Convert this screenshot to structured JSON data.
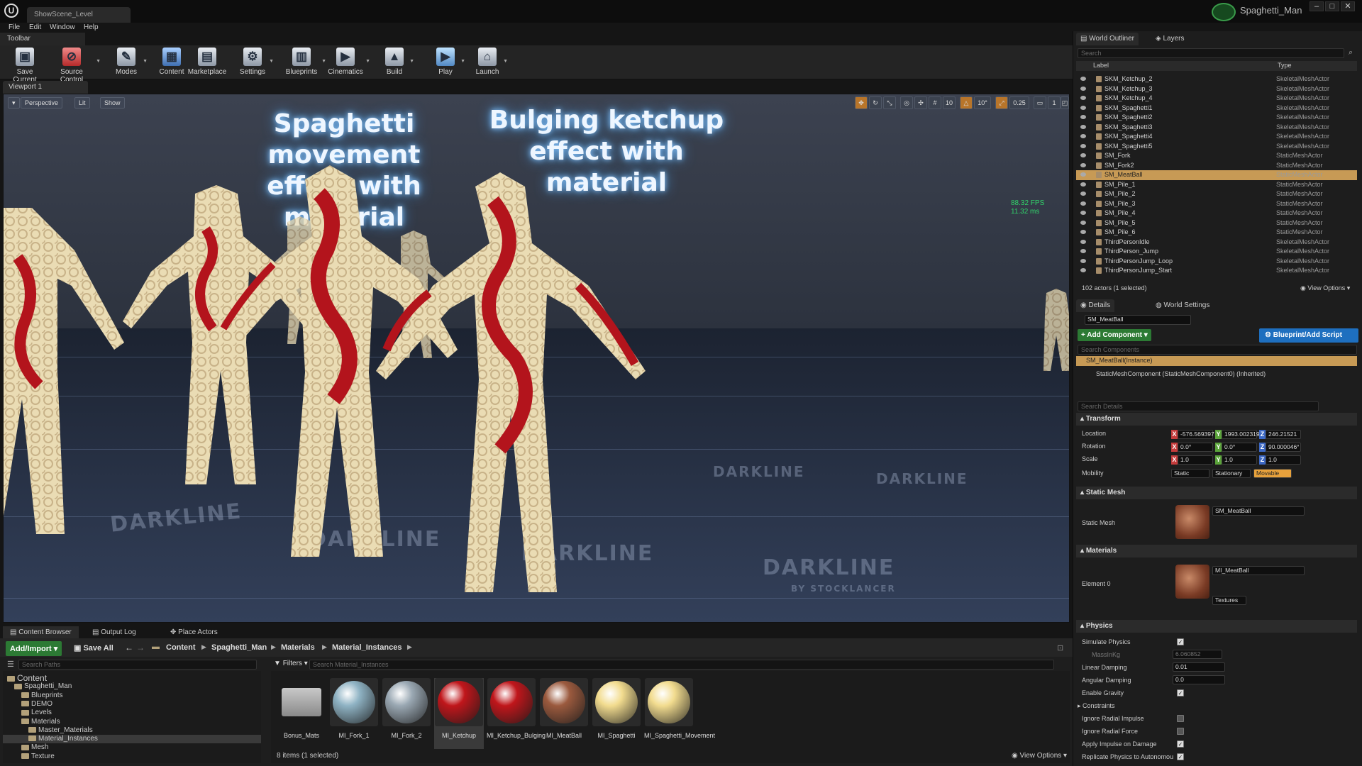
{
  "window": {
    "doc_tab": "ShowScene_Level",
    "user": "Spaghetti_Man",
    "controls": [
      "–",
      "□",
      "✕"
    ]
  },
  "menu": [
    "File",
    "Edit",
    "Window",
    "Help"
  ],
  "toolbar": {
    "tab": "Toolbar",
    "buttons": [
      "Save Current",
      "Source Control",
      "Modes",
      "Content",
      "Marketplace",
      "Settings",
      "Blueprints",
      "Cinematics",
      "Build",
      "Play",
      "Launch"
    ]
  },
  "viewport": {
    "tab": "Viewport 1",
    "perspective": "Perspective",
    "lit": "Lit",
    "show": "Show",
    "grid_snap": "10",
    "rot_snap": "10°",
    "scale_snap": "0.25",
    "cam_speed": "1",
    "fps": "88.32 FPS",
    "ms": "11.32 ms",
    "headline_left_1": "Spaghetti movement",
    "headline_left_2": "effect with material",
    "headline_right_1": "Bulging ketchup",
    "headline_right_2": "effect with material",
    "watermark": "DARKLINE",
    "watermark_sub": "BY STOCKLANCER"
  },
  "content_browser": {
    "tabs": [
      "Content Browser",
      "Output Log",
      "Place Actors"
    ],
    "add_import": "Add/Import",
    "save_all": "Save All",
    "crumbs": [
      "Content",
      "Spaghetti_Man",
      "Materials",
      "Material_Instances"
    ],
    "search_paths": "Search Paths",
    "filters": "Filters",
    "search_assets": "Search Material_Instances",
    "tree": [
      {
        "label": "Content",
        "depth": 0
      },
      {
        "label": "Spaghetti_Man",
        "depth": 1
      },
      {
        "label": "Blueprints",
        "depth": 2
      },
      {
        "label": "DEMO",
        "depth": 2
      },
      {
        "label": "Levels",
        "depth": 2
      },
      {
        "label": "Materials",
        "depth": 2
      },
      {
        "label": "Master_Materials",
        "depth": 3
      },
      {
        "label": "Material_Instances",
        "depth": 3
      },
      {
        "label": "Mesh",
        "depth": 2
      },
      {
        "label": "Texture",
        "depth": 2
      }
    ],
    "assets": [
      {
        "label": "Bonus_Mats",
        "kind": "folder",
        "color": "#999999"
      },
      {
        "label": "MI_Fork_1",
        "kind": "ball",
        "color": "#8fb3c4"
      },
      {
        "label": "MI_Fork_2",
        "kind": "ball",
        "color": "#9aa8b3"
      },
      {
        "label": "MI_Ketchup",
        "kind": "ball",
        "color": "#c0161b"
      },
      {
        "label": "MI_Ketchup_Bulging",
        "kind": "ball",
        "color": "#c0161b"
      },
      {
        "label": "MI_MeatBall",
        "kind": "ball",
        "color": "#9b5a3e"
      },
      {
        "label": "MI_Spaghetti",
        "kind": "ball",
        "color": "#f2dc8f"
      },
      {
        "label": "MI_Spaghetti_Movement",
        "kind": "ball",
        "color": "#f2dc8f"
      }
    ],
    "items_count": "8 items (1 selected)",
    "view_options": "View Options"
  },
  "outliner": {
    "tabs": [
      "World Outliner",
      "Layers"
    ],
    "search": "Search",
    "col_label": "Label",
    "col_type": "Type",
    "rows": [
      {
        "label": "SKM_Ketchup_2",
        "type": "SkeletalMeshActor"
      },
      {
        "label": "SKM_Ketchup_3",
        "type": "SkeletalMeshActor"
      },
      {
        "label": "SKM_Ketchup_4",
        "type": "SkeletalMeshActor"
      },
      {
        "label": "SKM_Spaghetti1",
        "type": "SkeletalMeshActor"
      },
      {
        "label": "SKM_Spaghetti2",
        "type": "SkeletalMeshActor"
      },
      {
        "label": "SKM_Spaghetti3",
        "type": "SkeletalMeshActor"
      },
      {
        "label": "SKM_Spaghetti4",
        "type": "SkeletalMeshActor"
      },
      {
        "label": "SKM_Spaghetti5",
        "type": "SkeletalMeshActor"
      },
      {
        "label": "SM_Fork",
        "type": "StaticMeshActor"
      },
      {
        "label": "SM_Fork2",
        "type": "StaticMeshActor"
      },
      {
        "label": "SM_MeatBall",
        "type": "StaticMeshActor"
      },
      {
        "label": "SM_Pile_1",
        "type": "StaticMeshActor"
      },
      {
        "label": "SM_Pile_2",
        "type": "StaticMeshActor"
      },
      {
        "label": "SM_Pile_3",
        "type": "StaticMeshActor"
      },
      {
        "label": "SM_Pile_4",
        "type": "StaticMeshActor"
      },
      {
        "label": "SM_Pile_5",
        "type": "StaticMeshActor"
      },
      {
        "label": "SM_Pile_6",
        "type": "StaticMeshActor"
      },
      {
        "label": "ThirdPersonIdle",
        "type": "SkeletalMeshActor"
      },
      {
        "label": "ThirdPerson_Jump",
        "type": "SkeletalMeshActor"
      },
      {
        "label": "ThirdPersonJump_Loop",
        "type": "SkeletalMeshActor"
      },
      {
        "label": "ThirdPersonJump_Start",
        "type": "SkeletalMeshActor"
      }
    ],
    "selected_index": 10,
    "actors": "102 actors (1 selected)",
    "view_options": "View Options"
  },
  "details": {
    "tabs": [
      "Details",
      "World Settings"
    ],
    "name": "SM_MeatBall",
    "add_component": "+ Add Component",
    "blueprint": "Blueprint/Add Script",
    "search_components": "Search Components",
    "instance": "SM_MeatBall(Instance)",
    "component": "StaticMeshComponent (StaticMeshComponent0) (Inherited)",
    "search_details": "Search Details",
    "transform": "Transform",
    "location": "Location",
    "rotation": "Rotation",
    "scale": "Scale",
    "loc": [
      "-576.569397",
      "1993.002319",
      "246.21521"
    ],
    "rot": [
      "0.0°",
      "0.0°",
      "90.000046°"
    ],
    "scl": [
      "1.0",
      "1.0",
      "1.0"
    ],
    "mobility": "Mobility",
    "mob_opts": [
      "Static",
      "Stationary",
      "Movable"
    ],
    "static_mesh_header": "Static Mesh",
    "static_mesh_label": "Static Mesh",
    "static_mesh_value": "SM_MeatBall",
    "materials_header": "Materials",
    "element0": "Element 0",
    "material_value": "MI_MeatBall",
    "textures": "Textures",
    "physics": "Physics",
    "simulate_physics": "Simulate Physics",
    "mass": "MassInKg",
    "mass_value": "6.060852",
    "linear_damping": "Linear Damping",
    "linear_value": "0.01",
    "angular_damping": "Angular Damping",
    "angular_value": "0.0",
    "enable_gravity": "Enable Gravity",
    "constraints": "Constraints",
    "ignore_radial_impulse": "Ignore Radial Impulse",
    "ignore_radial_force": "Ignore Radial Force",
    "apply_impulse": "Apply Impulse on Damage",
    "replicate": "Replicate Physics to Autonomou"
  },
  "colors": {
    "accent": "#e8a23c",
    "selected_row": "#c79a55",
    "green": "#2c7a34",
    "blue": "#1e6fbf",
    "ketchup": "#c0161b",
    "spaghetti": "#f2dcb0"
  }
}
